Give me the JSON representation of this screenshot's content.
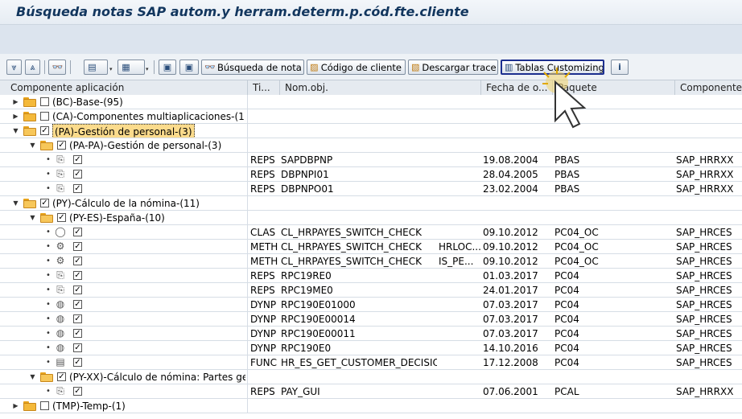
{
  "window": {
    "title": "Búsqueda notas SAP autom.y herram.determ.p.cód.fte.cliente"
  },
  "toolbar": {
    "btn_busqueda": "Búsqueda de nota",
    "btn_codigo": "Código de cliente",
    "btn_descargar": "Descargar trace",
    "btn_tablas": "Tablas Customizing"
  },
  "columns": {
    "componente": "Componente aplicación",
    "tipo": "Ti...",
    "nomobj": "Nom.obj.",
    "fecha": "Fecha de o...",
    "paquete": "Paquete",
    "componente2": "Componente"
  },
  "rows": [
    {
      "kind": "group",
      "level": 0,
      "tri": "right",
      "folder": "closed",
      "checked": false,
      "label": "(BC)-Base-(95)"
    },
    {
      "kind": "group",
      "level": 0,
      "tri": "right",
      "folder": "closed",
      "checked": false,
      "label": "(CA)-Componentes multiaplicaciones-(1)"
    },
    {
      "kind": "group",
      "level": 0,
      "tri": "down",
      "folder": "open",
      "checked": true,
      "label": "(PA)-Gestión de personal-(3)",
      "selected": true
    },
    {
      "kind": "group",
      "level": 1,
      "tri": "down",
      "folder": "open",
      "checked": true,
      "label": "(PA-PA)-Gestión de personal-(3)"
    },
    {
      "kind": "item",
      "icon": "report-icon",
      "type": "REPS",
      "name": "SAPDBPNP",
      "sub": "",
      "date": "19.08.2004",
      "package": "PBAS",
      "component": "SAP_HRRXX"
    },
    {
      "kind": "item",
      "icon": "report-icon",
      "type": "REPS",
      "name": "DBPNPI01",
      "sub": "",
      "date": "28.04.2005",
      "package": "PBAS",
      "component": "SAP_HRRXX"
    },
    {
      "kind": "item",
      "icon": "report-icon",
      "type": "REPS",
      "name": "DBPNPO01",
      "sub": "",
      "date": "23.02.2004",
      "package": "PBAS",
      "component": "SAP_HRRXX"
    },
    {
      "kind": "group",
      "level": 0,
      "tri": "down",
      "folder": "open",
      "checked": true,
      "label": "(PY)-Cálculo de la nómina-(11)"
    },
    {
      "kind": "group",
      "level": 1,
      "tri": "down",
      "folder": "open",
      "checked": true,
      "label": "(PY-ES)-España-(10)"
    },
    {
      "kind": "item",
      "icon": "class-icon",
      "type": "CLAS",
      "name": "CL_HRPAYES_SWITCH_CHECK",
      "sub": "",
      "date": "09.10.2012",
      "package": "PC04_OC",
      "component": "SAP_HRCES"
    },
    {
      "kind": "item",
      "icon": "method-icon",
      "type": "METH",
      "name": "CL_HRPAYES_SWITCH_CHECK",
      "sub": "HRLOC...",
      "date": "09.10.2012",
      "package": "PC04_OC",
      "component": "SAP_HRCES"
    },
    {
      "kind": "item",
      "icon": "method-icon",
      "type": "METH",
      "name": "CL_HRPAYES_SWITCH_CHECK",
      "sub": "IS_PE...",
      "date": "09.10.2012",
      "package": "PC04_OC",
      "component": "SAP_HRCES"
    },
    {
      "kind": "item",
      "icon": "report-icon",
      "type": "REPS",
      "name": "RPC19RE0",
      "sub": "",
      "date": "01.03.2017",
      "package": "PC04",
      "component": "SAP_HRCES"
    },
    {
      "kind": "item",
      "icon": "report-icon",
      "type": "REPS",
      "name": "RPC19ME0",
      "sub": "",
      "date": "24.01.2017",
      "package": "PC04",
      "component": "SAP_HRCES"
    },
    {
      "kind": "item",
      "icon": "dynpro-icon",
      "type": "DYNP",
      "name": "RPC190E01000",
      "sub": "",
      "date": "07.03.2017",
      "package": "PC04",
      "component": "SAP_HRCES"
    },
    {
      "kind": "item",
      "icon": "dynpro-icon",
      "type": "DYNP",
      "name": "RPC190E00014",
      "sub": "",
      "date": "07.03.2017",
      "package": "PC04",
      "component": "SAP_HRCES"
    },
    {
      "kind": "item",
      "icon": "dynpro-icon",
      "type": "DYNP",
      "name": "RPC190E00011",
      "sub": "",
      "date": "07.03.2017",
      "package": "PC04",
      "component": "SAP_HRCES"
    },
    {
      "kind": "item",
      "icon": "dynpro-icon",
      "type": "DYNP",
      "name": "RPC190E0",
      "sub": "",
      "date": "14.10.2016",
      "package": "PC04",
      "component": "SAP_HRCES"
    },
    {
      "kind": "item",
      "icon": "function-icon",
      "type": "FUNC",
      "name": "HR_ES_GET_CUSTOMER_DECISION",
      "sub": "",
      "date": "17.12.2008",
      "package": "PC04",
      "component": "SAP_HRCES"
    },
    {
      "kind": "group",
      "level": 1,
      "tri": "down",
      "folder": "open",
      "checked": true,
      "label": "(PY-XX)-Cálculo de nómina: Partes gene"
    },
    {
      "kind": "item",
      "icon": "report-icon",
      "type": "REPS",
      "name": "PAY_GUI",
      "sub": "",
      "date": "07.06.2001",
      "package": "PCAL",
      "component": "SAP_HRRXX"
    },
    {
      "kind": "group",
      "level": 0,
      "tri": "right",
      "folder": "closed",
      "checked": false,
      "label": "(TMP)-Temp-(1)"
    }
  ]
}
